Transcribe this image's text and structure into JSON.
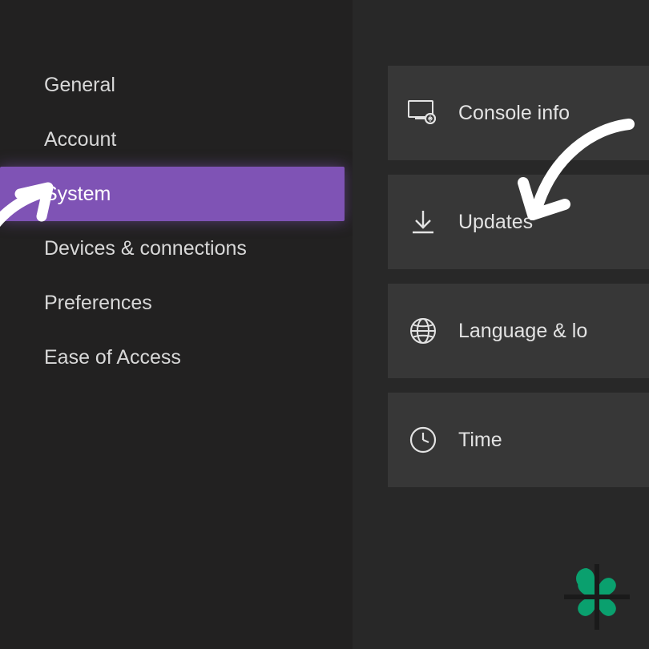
{
  "sidebar": {
    "items": [
      {
        "label": "General"
      },
      {
        "label": "Account"
      },
      {
        "label": "System"
      },
      {
        "label": "Devices & connections"
      },
      {
        "label": "Preferences"
      },
      {
        "label": "Ease of Access"
      }
    ],
    "selected_index": 2
  },
  "main": {
    "tiles": [
      {
        "icon": "console-info-icon",
        "label": "Console info"
      },
      {
        "icon": "download-icon",
        "label": "Updates"
      },
      {
        "icon": "globe-icon",
        "label": "Language & lo"
      },
      {
        "icon": "clock-icon",
        "label": "Time"
      }
    ]
  },
  "colors": {
    "selected": "#7f53b5",
    "brand": "#0aa06e"
  }
}
